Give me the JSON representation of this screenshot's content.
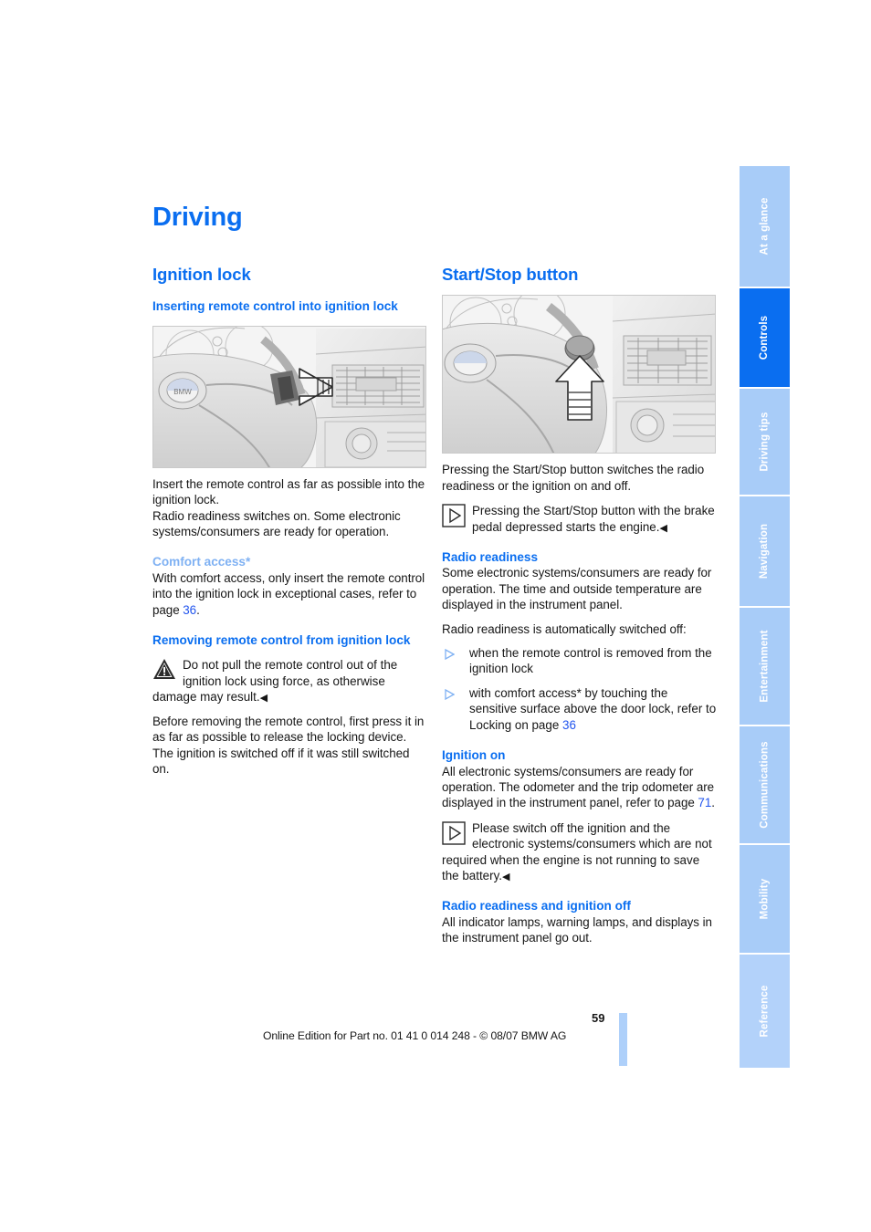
{
  "chapter_title": "Driving",
  "page_number": "59",
  "footer_text": "Online Edition for Part no. 01 41 0 014 248 - © 08/07 BMW AG",
  "colors": {
    "heading_blue": "#0a6ef0",
    "pale_blue": "#7fb1f3",
    "tab_blue": "#a8ccf8",
    "tab_active_blue": "#0a6ef0",
    "link_blue": "#2255ee"
  },
  "side_tabs": [
    {
      "label": "At a glance",
      "active": false
    },
    {
      "label": "Controls",
      "active": true
    },
    {
      "label": "Driving tips",
      "active": false
    },
    {
      "label": "Navigation",
      "active": false
    },
    {
      "label": "Entertainment",
      "active": false
    },
    {
      "label": "Communications",
      "active": false
    },
    {
      "label": "Mobility",
      "active": false
    },
    {
      "label": "Reference",
      "active": false
    }
  ],
  "left_column": {
    "section_title": "Ignition lock",
    "sub1_title": "Inserting remote control into ignition lock",
    "figure1_code": "",
    "para1": "Insert the remote control as far as possible into the ignition lock.",
    "para2": "Radio readiness switches on. Some electronic systems/consumers are ready for operation.",
    "sub2_title": "Comfort access*",
    "para3_a": "With comfort access, only insert the remote control into the ignition lock in exceptional cases, refer to page ",
    "para3_ref": "36",
    "para3_b": ".",
    "sub3_title": "Removing remote control from ignition lock",
    "warning_text": "Do not pull the remote control out of the ignition lock using force, as otherwise damage may result.",
    "warning_end": "◀",
    "para4": "Before removing the remote control, first press it in as far as possible to release the locking device.",
    "para5": "The ignition is switched off if it was still switched on."
  },
  "right_column": {
    "section_title": "Start/Stop button",
    "figure2_code": "",
    "para1": "Pressing the Start/Stop button switches the radio readiness or the ignition on and off.",
    "note1_text": "Pressing the Start/Stop button with the brake pedal depressed starts the engine.",
    "note1_end": "◀",
    "sub1_title": "Radio readiness",
    "para2": "Some electronic systems/consumers are ready for operation. The time and outside temperature are displayed in the instrument panel.",
    "para3": "Radio readiness is automatically switched off:",
    "bullets": [
      {
        "text": "when the remote control is removed from the ignition lock"
      },
      {
        "text_a": "with comfort access",
        "star": "*",
        "text_b": " by touching the sensitive surface above the door lock, refer to Locking on page ",
        "ref": "36"
      }
    ],
    "sub2_title": "Ignition on",
    "para4_a": "All electronic systems/consumers are ready for operation. The odometer and the trip odometer are displayed in the instrument panel, refer to page ",
    "para4_ref": "71",
    "para4_b": ".",
    "note2_text": "Please switch off the ignition and the electronic systems/consumers which are not required when the engine is not running to save the battery.",
    "note2_end": "◀",
    "sub3_title": "Radio readiness and ignition off",
    "para5": "All indicator lamps, warning lamps, and displays in the instrument panel go out."
  },
  "figures": {
    "left_alt": "BMW steering wheel and dashboard with arrow pointing to ignition lock",
    "right_alt": "BMW steering wheel and dashboard with arrow pointing up to Start/Stop button"
  }
}
